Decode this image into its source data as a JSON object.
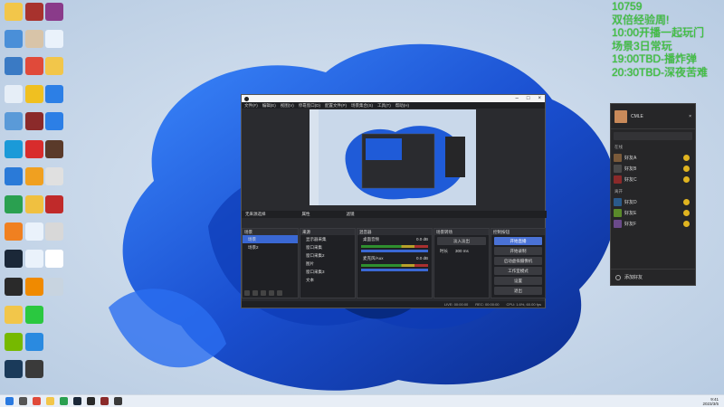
{
  "overlay": {
    "lines": [
      "10759",
      "双倍经验周!",
      "10:00开播一起玩门",
      "场景3日常玩",
      "19:00TBD-播炸弹",
      "20:30TBD-深夜苦难"
    ]
  },
  "obs": {
    "menu": [
      "文件(F)",
      "编辑(E)",
      "视图(V)",
      "停靠窗口(D)",
      "配置文件(P)",
      "场景集合(S)",
      "工具(T)",
      "帮助(H)"
    ],
    "mode_label": "无来源选择",
    "props_button": "属性",
    "filters_button": "滤镜",
    "scenes_header": "场景",
    "scenes": [
      "场景",
      "场景2"
    ],
    "sources_header": "来源",
    "sources": [
      "显示器采集",
      "窗口采集",
      "窗口采集2",
      "图片",
      "窗口采集3",
      "文本"
    ],
    "mixer_header": "混音器",
    "mixer": [
      {
        "name": "桌面音频",
        "level": "0.0 dB"
      },
      {
        "name": "麦克风/Aux",
        "level": "0.0 dB"
      }
    ],
    "transitions_header": "场景转场",
    "transition": "淡入淡出",
    "duration_label": "时长",
    "duration": "300 ms",
    "controls_header": "控制按钮",
    "controls": [
      "开始直播",
      "开始录制",
      "启动虚拟摄像机",
      "工作室模式",
      "设置",
      "退出"
    ],
    "status": [
      "LIVE: 00:00:00",
      "REC: 00:00:00",
      "CPU: 1.6%, 60.00 fps"
    ]
  },
  "chat": {
    "username": "CMLE",
    "group_online": "在线",
    "group_away": "离开",
    "friends_online": [
      "好友A",
      "好友B",
      "好友C"
    ],
    "friends_away": [
      "好友D",
      "好友E",
      "好友F"
    ],
    "footer": "添加好友"
  },
  "clock": {
    "time": "9:41",
    "date": "2023/3/5"
  },
  "colors": {
    "accent": "#4a72d6",
    "overlay_text": "#3ec83e",
    "wall_blue": "#1f5bd8"
  }
}
